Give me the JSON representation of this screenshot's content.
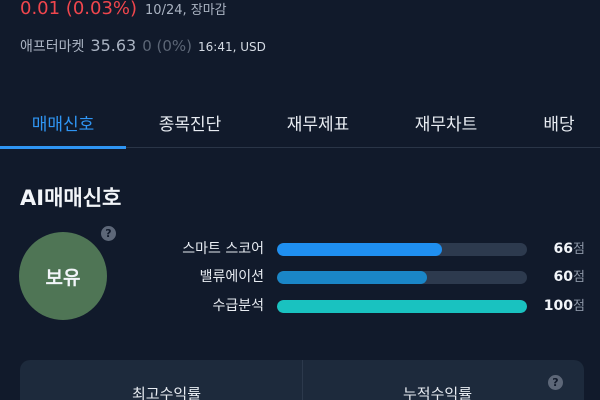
{
  "quote": {
    "price_change": "0.01 (0.03%)",
    "market_time": "10/24, 장마감",
    "after_market": {
      "label": "애프터마켓",
      "price": "35.63",
      "change": "0 (0%)",
      "time": "16:41, USD"
    }
  },
  "tabs": [
    {
      "label": "매매신호",
      "active": true
    },
    {
      "label": "종목진단",
      "active": false
    },
    {
      "label": "재무제표",
      "active": false
    },
    {
      "label": "재무차트",
      "active": false
    },
    {
      "label": "배당",
      "active": false
    }
  ],
  "ai_signal": {
    "title": "AI매매신호",
    "signal": "보유",
    "help_symbol": "?",
    "signal_color": "#4f7555",
    "metrics": [
      {
        "label": "스마트 스코어",
        "value": "66",
        "unit": "점",
        "percent": 66,
        "color": "#1f8ff0"
      },
      {
        "label": "밸류에이션",
        "value": "60",
        "unit": "점",
        "percent": 60,
        "color": "#1a86c7"
      },
      {
        "label": "수급분석",
        "value": "100",
        "unit": "점",
        "percent": 100,
        "color": "#19c2c0"
      }
    ]
  },
  "returns": {
    "max_return_label": "최고수익률",
    "cumulative_return_label": "누적수익률",
    "help_symbol": "?"
  },
  "colors": {
    "background": "#111a2b",
    "accent": "#2f95f3",
    "price_down": "#f0464d"
  }
}
